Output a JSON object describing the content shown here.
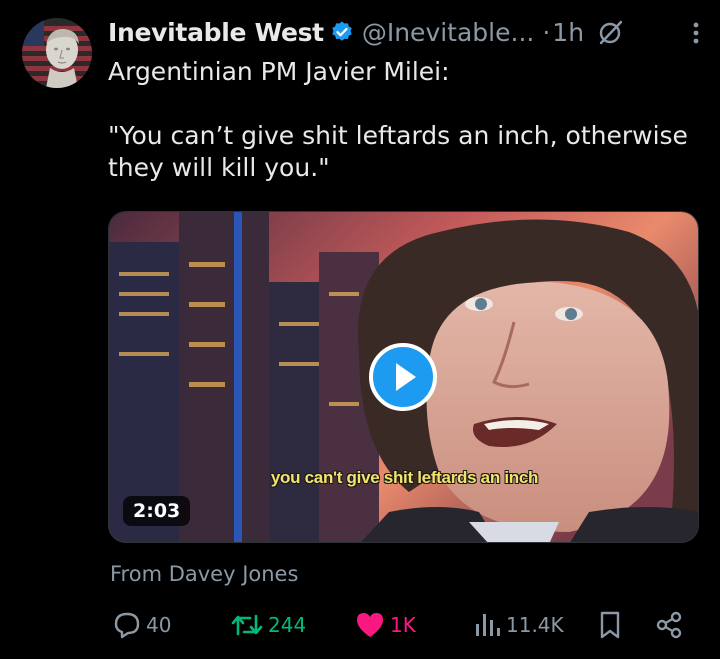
{
  "author": {
    "name": "Inevitable West",
    "handle": "@Inevitable...",
    "separator": "·",
    "time": "1h"
  },
  "tweet": {
    "line1": "Argentinian PM Javier Milei:",
    "quote": "\"You can’t give shit leftards an inch, otherwise they will kill you.\""
  },
  "media": {
    "subtitle": "you can't give shit leftards an inch",
    "duration": "2:03"
  },
  "attribution": "From Davey Jones",
  "actions": {
    "replies": "40",
    "reposts": "244",
    "likes": "1K",
    "views": "11.4K"
  },
  "colors": {
    "background": "#000000",
    "text": "#e7e9ea",
    "muted": "#8b98a5",
    "verified": "#1d9bf0",
    "repost": "#00ba7c",
    "like": "#f91880",
    "play": "#1d9bf0"
  },
  "icons": [
    "verified-badge-icon",
    "grok-icon",
    "more-options-icon",
    "play-icon",
    "reply-icon",
    "repost-icon",
    "like-icon",
    "views-icon",
    "bookmark-icon",
    "share-icon"
  ]
}
